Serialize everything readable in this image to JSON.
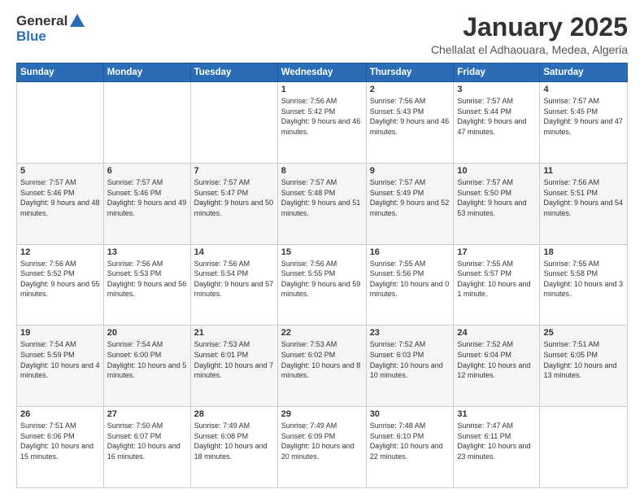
{
  "header": {
    "logo_line1": "General",
    "logo_line2": "Blue",
    "month": "January 2025",
    "location": "Chellalat el Adhaouara, Medea, Algeria"
  },
  "days_of_week": [
    "Sunday",
    "Monday",
    "Tuesday",
    "Wednesday",
    "Thursday",
    "Friday",
    "Saturday"
  ],
  "weeks": [
    [
      {
        "day": "",
        "info": ""
      },
      {
        "day": "",
        "info": ""
      },
      {
        "day": "",
        "info": ""
      },
      {
        "day": "1",
        "info": "Sunrise: 7:56 AM\nSunset: 5:42 PM\nDaylight: 9 hours and 46 minutes."
      },
      {
        "day": "2",
        "info": "Sunrise: 7:56 AM\nSunset: 5:43 PM\nDaylight: 9 hours and 46 minutes."
      },
      {
        "day": "3",
        "info": "Sunrise: 7:57 AM\nSunset: 5:44 PM\nDaylight: 9 hours and 47 minutes."
      },
      {
        "day": "4",
        "info": "Sunrise: 7:57 AM\nSunset: 5:45 PM\nDaylight: 9 hours and 47 minutes."
      }
    ],
    [
      {
        "day": "5",
        "info": "Sunrise: 7:57 AM\nSunset: 5:46 PM\nDaylight: 9 hours and 48 minutes."
      },
      {
        "day": "6",
        "info": "Sunrise: 7:57 AM\nSunset: 5:46 PM\nDaylight: 9 hours and 49 minutes."
      },
      {
        "day": "7",
        "info": "Sunrise: 7:57 AM\nSunset: 5:47 PM\nDaylight: 9 hours and 50 minutes."
      },
      {
        "day": "8",
        "info": "Sunrise: 7:57 AM\nSunset: 5:48 PM\nDaylight: 9 hours and 51 minutes."
      },
      {
        "day": "9",
        "info": "Sunrise: 7:57 AM\nSunset: 5:49 PM\nDaylight: 9 hours and 52 minutes."
      },
      {
        "day": "10",
        "info": "Sunrise: 7:57 AM\nSunset: 5:50 PM\nDaylight: 9 hours and 53 minutes."
      },
      {
        "day": "11",
        "info": "Sunrise: 7:56 AM\nSunset: 5:51 PM\nDaylight: 9 hours and 54 minutes."
      }
    ],
    [
      {
        "day": "12",
        "info": "Sunrise: 7:56 AM\nSunset: 5:52 PM\nDaylight: 9 hours and 55 minutes."
      },
      {
        "day": "13",
        "info": "Sunrise: 7:56 AM\nSunset: 5:53 PM\nDaylight: 9 hours and 56 minutes."
      },
      {
        "day": "14",
        "info": "Sunrise: 7:56 AM\nSunset: 5:54 PM\nDaylight: 9 hours and 57 minutes."
      },
      {
        "day": "15",
        "info": "Sunrise: 7:56 AM\nSunset: 5:55 PM\nDaylight: 9 hours and 59 minutes."
      },
      {
        "day": "16",
        "info": "Sunrise: 7:55 AM\nSunset: 5:56 PM\nDaylight: 10 hours and 0 minutes."
      },
      {
        "day": "17",
        "info": "Sunrise: 7:55 AM\nSunset: 5:57 PM\nDaylight: 10 hours and 1 minute."
      },
      {
        "day": "18",
        "info": "Sunrise: 7:55 AM\nSunset: 5:58 PM\nDaylight: 10 hours and 3 minutes."
      }
    ],
    [
      {
        "day": "19",
        "info": "Sunrise: 7:54 AM\nSunset: 5:59 PM\nDaylight: 10 hours and 4 minutes."
      },
      {
        "day": "20",
        "info": "Sunrise: 7:54 AM\nSunset: 6:00 PM\nDaylight: 10 hours and 5 minutes."
      },
      {
        "day": "21",
        "info": "Sunrise: 7:53 AM\nSunset: 6:01 PM\nDaylight: 10 hours and 7 minutes."
      },
      {
        "day": "22",
        "info": "Sunrise: 7:53 AM\nSunset: 6:02 PM\nDaylight: 10 hours and 8 minutes."
      },
      {
        "day": "23",
        "info": "Sunrise: 7:52 AM\nSunset: 6:03 PM\nDaylight: 10 hours and 10 minutes."
      },
      {
        "day": "24",
        "info": "Sunrise: 7:52 AM\nSunset: 6:04 PM\nDaylight: 10 hours and 12 minutes."
      },
      {
        "day": "25",
        "info": "Sunrise: 7:51 AM\nSunset: 6:05 PM\nDaylight: 10 hours and 13 minutes."
      }
    ],
    [
      {
        "day": "26",
        "info": "Sunrise: 7:51 AM\nSunset: 6:06 PM\nDaylight: 10 hours and 15 minutes."
      },
      {
        "day": "27",
        "info": "Sunrise: 7:50 AM\nSunset: 6:07 PM\nDaylight: 10 hours and 16 minutes."
      },
      {
        "day": "28",
        "info": "Sunrise: 7:49 AM\nSunset: 6:08 PM\nDaylight: 10 hours and 18 minutes."
      },
      {
        "day": "29",
        "info": "Sunrise: 7:49 AM\nSunset: 6:09 PM\nDaylight: 10 hours and 20 minutes."
      },
      {
        "day": "30",
        "info": "Sunrise: 7:48 AM\nSunset: 6:10 PM\nDaylight: 10 hours and 22 minutes."
      },
      {
        "day": "31",
        "info": "Sunrise: 7:47 AM\nSunset: 6:11 PM\nDaylight: 10 hours and 23 minutes."
      },
      {
        "day": "",
        "info": ""
      }
    ]
  ]
}
